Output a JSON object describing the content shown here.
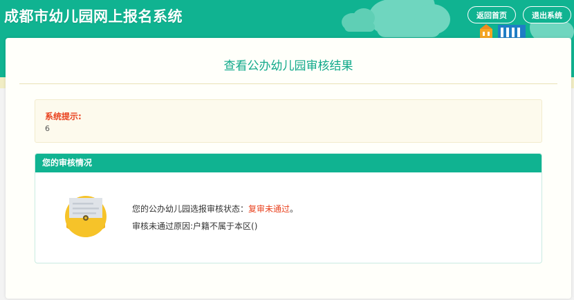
{
  "header": {
    "site_title": "成都市幼儿园网上报名系统",
    "home_button": "返回首页",
    "exit_button": "退出系统"
  },
  "main": {
    "page_title": "查看公办幼儿园审核结果",
    "notice": {
      "title": "系统提示:",
      "text": "6"
    },
    "review": {
      "header": "您的审核情况",
      "status_label": "您的公办幼儿园选报审核状态：",
      "status_value": "复审未通过",
      "status_suffix": "。",
      "reason": "审核未通过原因:户籍不属于本区()"
    }
  },
  "colors": {
    "brand_green": "#10b391",
    "alert_red": "#e9421f",
    "title_green": "#10a98a"
  }
}
